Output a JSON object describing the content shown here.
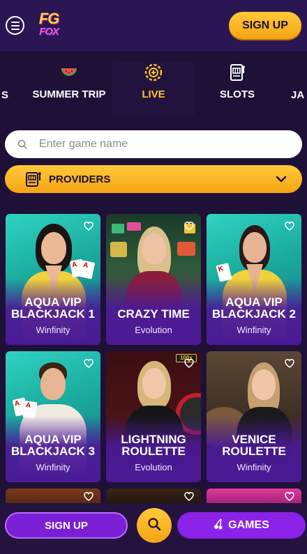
{
  "header": {
    "logo_line1": "FG",
    "logo_line2": "FOX",
    "signup_label": "SIGN UP"
  },
  "tabs": {
    "partial_left": "S",
    "items": [
      {
        "label": "SUMMER TRIP",
        "icon": "watermelon-icon",
        "active": false
      },
      {
        "label": "LIVE",
        "icon": "live-chip-icon",
        "active": true
      },
      {
        "label": "SLOTS",
        "icon": "slot-machine-icon",
        "active": false
      }
    ],
    "partial_right": "JA"
  },
  "search": {
    "placeholder": "Enter game name"
  },
  "providers": {
    "label": "PROVIDERS"
  },
  "games": [
    {
      "title": "AQUA VIP BLACKJACK 1",
      "provider": "Winfinity"
    },
    {
      "title": "CRAZY TIME",
      "provider": "Evolution"
    },
    {
      "title": "AQUA VIP BLACKJACK 2",
      "provider": "Winfinity"
    },
    {
      "title": "AQUA VIP BLACKJACK 3",
      "provider": "Winfinity"
    },
    {
      "title": "LIGHTNING ROULETTE",
      "provider": "Evolution"
    },
    {
      "title": "VENICE ROULETTE",
      "provider": "Winfinity"
    }
  ],
  "bottom_bar": {
    "signup_label": "SIGN UP",
    "games_label": "GAMES"
  },
  "colors": {
    "background": "#1e1036",
    "header": "#2b1654",
    "accent_yellow": "#ffc42a",
    "accent_purple": "#8a22e8"
  }
}
